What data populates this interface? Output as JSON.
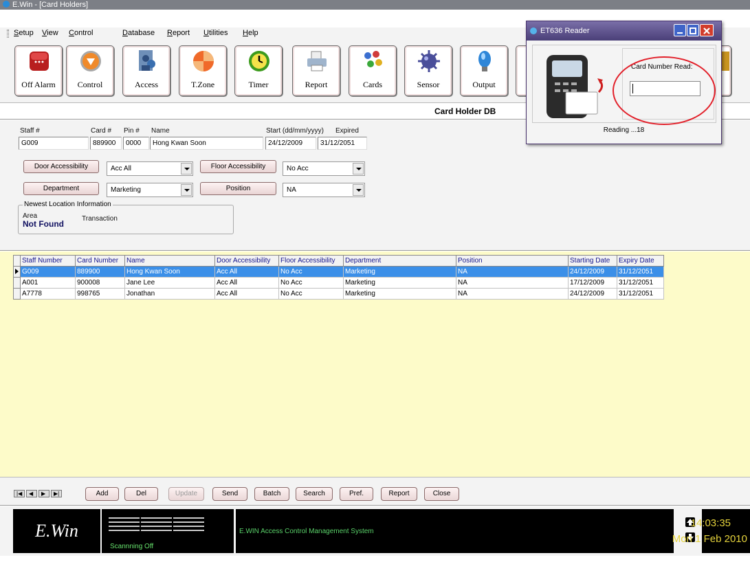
{
  "window": {
    "title": "E.Win - [Card Holders]"
  },
  "menu": [
    "Setup",
    "View",
    "Control",
    "Database",
    "Report",
    "Utilities",
    "Help"
  ],
  "toolbar": [
    {
      "label": "Off Alarm",
      "icon": "alarm-icon"
    },
    {
      "label": "Control",
      "icon": "control-icon"
    },
    {
      "label": "Access",
      "icon": "access-icon"
    },
    {
      "label": "T.Zone",
      "icon": "timezone-icon"
    },
    {
      "label": "Timer",
      "icon": "clock-icon"
    },
    {
      "label": "Report",
      "icon": "printer-icon"
    },
    {
      "label": "Cards",
      "icon": "cards-icon"
    },
    {
      "label": "Sensor",
      "icon": "sensor-icon"
    },
    {
      "label": "Output",
      "icon": "bulb-icon"
    }
  ],
  "page_title": "Card Holder DB",
  "form": {
    "labels": {
      "staff": "Staff #",
      "card": "Card #",
      "pin": "Pin #",
      "name": "Name",
      "start": "Start (dd/mm/yyyy)",
      "expired": "Expired"
    },
    "values": {
      "staff": "G009",
      "card": "889900",
      "pin": "0000",
      "name": "Hong Kwan Soon",
      "start": "24/12/2009",
      "expired": "31/12/2051"
    },
    "door_btn": "Door Accessibility",
    "door_value": "Acc All",
    "floor_btn": "Floor Accessibility",
    "floor_value": "No Acc",
    "dept_btn": "Department",
    "dept_value": "Marketing",
    "pos_btn": "Position",
    "pos_value": "NA",
    "location": {
      "legend": "Newest Location Information",
      "area_label": "Area",
      "transaction_label": "Transaction",
      "area_value": "Not Found"
    }
  },
  "table": {
    "columns": [
      "Staff Number",
      "Card Number",
      "Name",
      "Door Accessibility",
      "Floor Accessibility",
      "Department",
      "Position",
      "Starting Date",
      "Expiry Date"
    ],
    "rows": [
      [
        "G009",
        "889900",
        "Hong Kwan Soon",
        "Acc All",
        "No Acc",
        "Marketing",
        "NA",
        "24/12/2009",
        "31/12/2051"
      ],
      [
        "A001",
        "900008",
        "Jane Lee",
        "Acc All",
        "No Acc",
        "Marketing",
        "NA",
        "17/12/2009",
        "31/12/2051"
      ],
      [
        "A7778",
        "998765",
        "Jonathan",
        "Acc All",
        "No Acc",
        "Marketing",
        "NA",
        "24/12/2009",
        "31/12/2051"
      ]
    ],
    "selected_row": 0
  },
  "nav_controls": [
    "first",
    "prev",
    "next",
    "last"
  ],
  "actions": [
    "Add",
    "Del",
    "Update",
    "Send",
    "Batch",
    "Search",
    "Pref.",
    "Report",
    "Close"
  ],
  "status": {
    "logo": "E.Win",
    "scan": "Scannning Off",
    "message": "E.WIN Access Control Management System",
    "time": "14:03:35",
    "date": "Mon  1 Feb 2010"
  },
  "reader": {
    "title": "ET636 Reader",
    "label": "Card Number Read:",
    "value": "",
    "status": "Reading ...18"
  },
  "colors": {
    "selected_row": "#3b8fe8",
    "grid_bg": "#fdfbc9",
    "header_text": "#14148c",
    "highlight_circle": "#e2202a"
  }
}
